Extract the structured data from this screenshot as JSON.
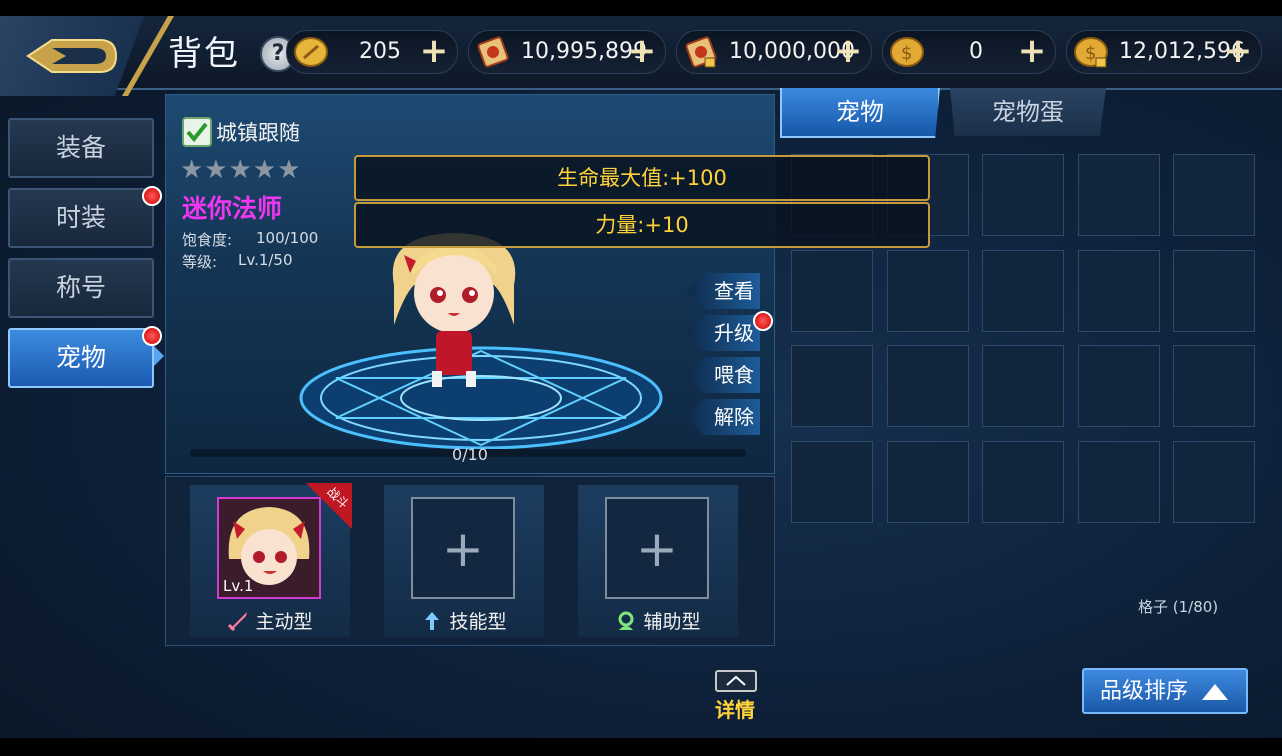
{
  "header": {
    "title": "背包",
    "help_icon": "question-icon",
    "currencies": [
      {
        "icon": "gold-coin-icon",
        "value": "205"
      },
      {
        "icon": "scroll-ticket-icon",
        "value": "10,995,899"
      },
      {
        "icon": "locked-scroll-icon",
        "value": "10,000,000"
      },
      {
        "icon": "silver-coin-icon",
        "value": "0"
      },
      {
        "icon": "locked-coin-icon",
        "value": "12,012,596"
      }
    ]
  },
  "sidebar": {
    "items": [
      {
        "label": "装备",
        "active": false,
        "badge": false
      },
      {
        "label": "时装",
        "active": false,
        "badge": true
      },
      {
        "label": "称号",
        "active": false,
        "badge": false
      },
      {
        "label": "宠物",
        "active": true,
        "badge": true
      }
    ]
  },
  "pet": {
    "follow_label": "城镇跟随",
    "follow_checked": true,
    "stars": "★★★★★",
    "name": "迷你法师",
    "satiety_label": "饱食度:",
    "satiety_value": "100/100",
    "level_label": "等级:",
    "level_value": "Lv.1/50",
    "attributes": [
      "生命最大值:+100",
      "力量:+10"
    ],
    "actions": [
      "查看",
      "升级",
      "喂食",
      "解除"
    ],
    "exp_text": "0/10",
    "exp_progress": 0
  },
  "slots": [
    {
      "type": "主动型",
      "filled": true,
      "level": "Lv.1",
      "tag": "战斗",
      "icon": "sword-icon"
    },
    {
      "type": "技能型",
      "filled": false,
      "plus": "+",
      "icon": "skill-arrow-icon"
    },
    {
      "type": "辅助型",
      "filled": false,
      "plus": "+",
      "icon": "support-icon"
    }
  ],
  "tabs": {
    "pet": "宠物",
    "pet_egg": "宠物蛋"
  },
  "grid": {
    "count_text": "格子 (1/80)"
  },
  "sort_label": "品级排序",
  "detail_label": "详情"
}
